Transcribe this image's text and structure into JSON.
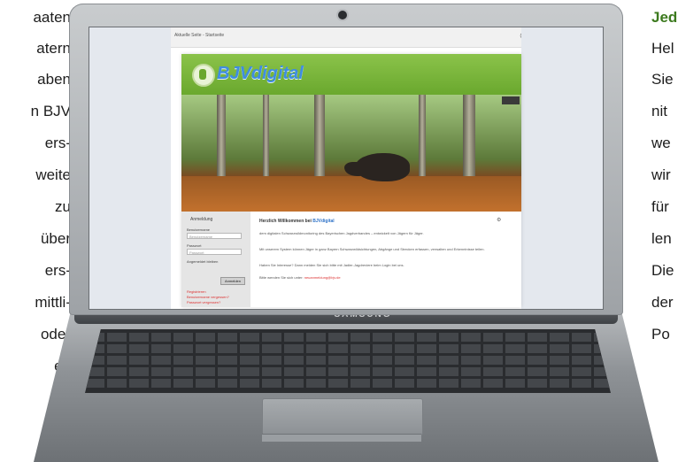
{
  "article": {
    "left_lines": [
      "aaten",
      "atern",
      "aben",
      "n BJV",
      "ers-",
      "weite",
      "zu",
      "über",
      "ers-",
      "mittli-",
      "oder",
      "en"
    ],
    "right_heading": "Jed",
    "right_lines": [
      "Hel",
      "Sie",
      "nit",
      "we",
      "wir",
      "für",
      "len",
      "Die",
      "der",
      "Po"
    ]
  },
  "laptop": {
    "brand": "SAMSUNG"
  },
  "screen": {
    "browser_tab": "Aktuelle Seite - Startseite",
    "site": {
      "logo_text": "BJVdigital",
      "login": {
        "title": "Anmeldung",
        "username_label": "Benutzername",
        "username_placeholder": "Benutzername",
        "password_label": "Passwort",
        "password_placeholder": "Passwort",
        "remember_label": "Angemeldet bleiben",
        "submit_label": "Anmelden",
        "links": [
          "Registrieren",
          "Benutzername vergessen?",
          "Passwort vergessen?"
        ]
      },
      "welcome": {
        "heading_prefix": "Herzlich Willkommen bei",
        "heading_brand": "BJVdigital",
        "paragraphs": [
          "dem digitalen Schwarzwildmonitoring des Bayerischen Jagdverbandes – entwickelt von Jägern für Jäger.",
          "Mit unserem System können Jäger in ganz Bayern Schwarzwildsichtungen, Abgänge und Strecken erfassen, verwalten und Erkenntnisse teilen.",
          "Haben Sie Interesse? Dann melden Sie sich bitte mit Jadler-Jagdreviere beim Login bei uns.",
          "Bitte wenden Sie sich unter:"
        ],
        "contact_email": "neuanmeldung@bjv.de"
      }
    }
  }
}
